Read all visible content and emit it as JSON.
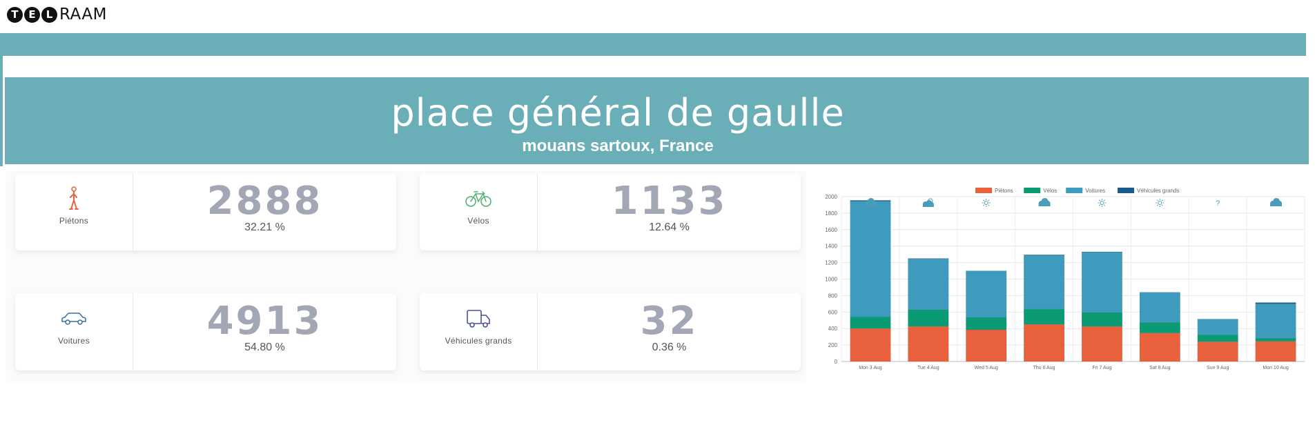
{
  "logo": {
    "letters": [
      "T",
      "E",
      "L"
    ],
    "rest": "RAAM"
  },
  "header": {
    "title": "place général de gaulle",
    "subtitle": "mouans sartoux, France"
  },
  "cards": [
    {
      "label": "Piétons",
      "count": "2888",
      "percent": "32.21 %",
      "icon": "pedestrian-icon",
      "color": "#e8603c"
    },
    {
      "label": "Vélos",
      "count": "1133",
      "percent": "12.64 %",
      "icon": "bicycle-icon",
      "color": "#4caf6d"
    },
    {
      "label": "Voitures",
      "count": "4913",
      "percent": "54.80 %",
      "icon": "car-icon",
      "color": "#3a6f9e"
    },
    {
      "label": "Véhicules grands",
      "count": "32",
      "percent": "0.36 %",
      "icon": "truck-icon",
      "color": "#4a4f9a"
    }
  ],
  "chart_data": {
    "type": "bar",
    "stacked": true,
    "categories": [
      "Mon 3 Aug",
      "Tue 4 Aug",
      "Wed 5 Aug",
      "Thu 6 Aug",
      "Fri 7 Aug",
      "Sat 8 Aug",
      "Sun 9 Aug",
      "Mon 10 Aug"
    ],
    "weather": [
      "cloud-icon",
      "sun-cloud-icon",
      "sun-icon",
      "cloud-icon",
      "sun-icon",
      "sun-icon",
      "unknown",
      "cloud-icon"
    ],
    "weather_unknown_label": "?",
    "series": [
      {
        "name": "Piétons",
        "color": "#e8603c",
        "values": [
          400,
          425,
          385,
          450,
          425,
          345,
          240,
          245
        ]
      },
      {
        "name": "Vélos",
        "color": "#0a9b74",
        "values": [
          140,
          205,
          150,
          185,
          170,
          130,
          85,
          35
        ]
      },
      {
        "name": "Voitures",
        "color": "#3f9bbd",
        "values": [
          1405,
          615,
          565,
          655,
          730,
          365,
          190,
          420
        ]
      },
      {
        "name": "Véhicules grands",
        "color": "#1b5a8a",
        "values": [
          10,
          5,
          0,
          5,
          5,
          0,
          0,
          15
        ]
      }
    ],
    "ylim": [
      0,
      2000
    ],
    "yticks": [
      0,
      200,
      400,
      600,
      800,
      1000,
      1200,
      1400,
      1600,
      1800,
      2000
    ],
    "legend_position": "top",
    "grid": true
  }
}
